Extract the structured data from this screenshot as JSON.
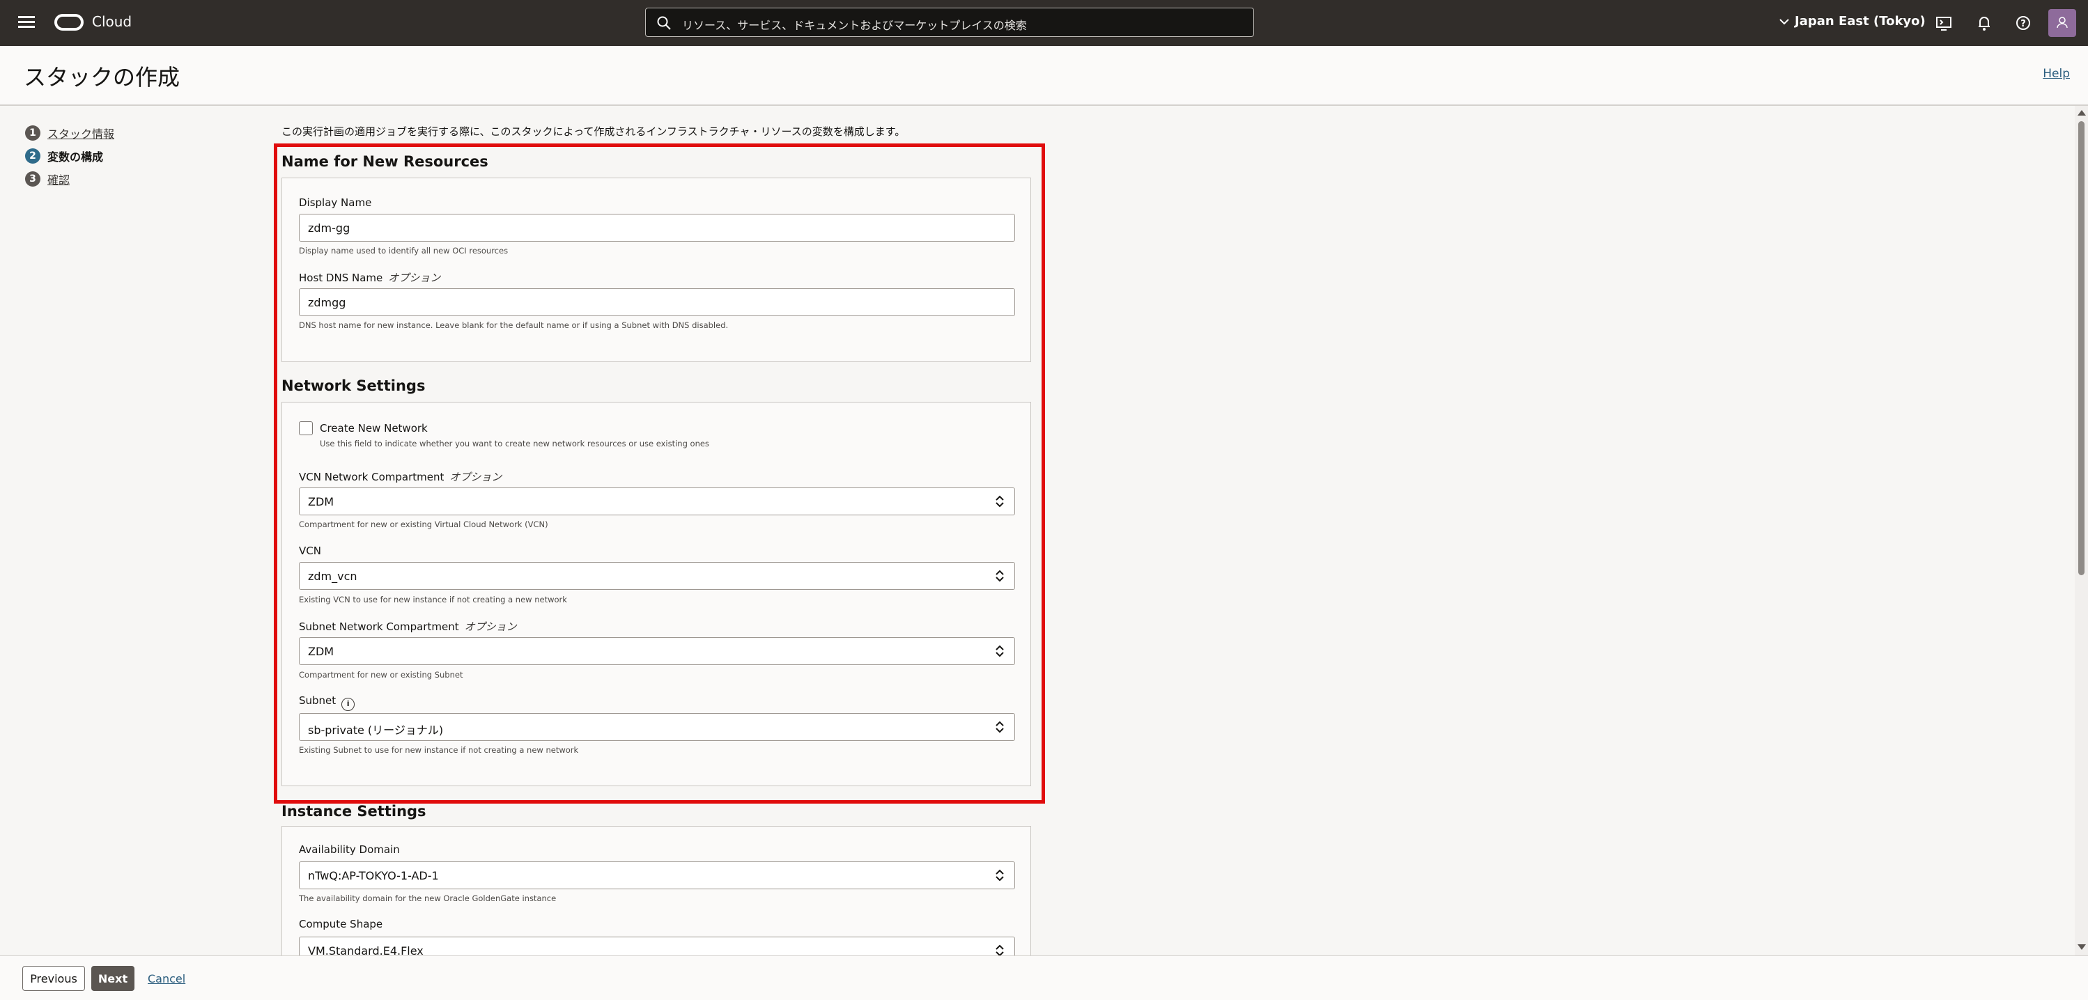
{
  "topbar": {
    "brand": "Cloud",
    "search_placeholder": "リソース、サービス、ドキュメントおよびマーケットプレイスの検索",
    "region": "Japan East (Tokyo)"
  },
  "header": {
    "title": "スタックの作成",
    "help": "Help"
  },
  "steps": [
    {
      "num": "1",
      "label": "スタック情報"
    },
    {
      "num": "2",
      "label": "変数の構成"
    },
    {
      "num": "3",
      "label": "確認"
    }
  ],
  "intro": "この実行計画の適用ジョブを実行する際に、このスタックによって作成されるインフラストラクチャ・リソースの変数を構成します。",
  "sections": {
    "names": {
      "title": "Name for New Resources",
      "display_name_label": "Display Name",
      "display_name_value": "zdm-gg",
      "display_name_hint": "Display name used to identify all new OCI resources",
      "host_dns_label": "Host DNS Name",
      "optional": "オプション",
      "host_dns_value": "zdmgg",
      "host_dns_hint": "DNS host name for new instance. Leave blank for the default name or if using a Subnet with DNS disabled."
    },
    "network": {
      "title": "Network Settings",
      "create_network_label": "Create New Network",
      "create_network_hint": "Use this field to indicate whether you want to create new network resources or use existing ones",
      "vcn_compartment_label": "VCN Network Compartment",
      "vcn_compartment_value": "ZDM",
      "vcn_compartment_hint": "Compartment for new or existing Virtual Cloud Network (VCN)",
      "vcn_label": "VCN",
      "vcn_value": "zdm_vcn",
      "vcn_hint": "Existing VCN to use for new instance if not creating a new network",
      "subnet_compartment_label": "Subnet Network Compartment",
      "subnet_compartment_value": "ZDM",
      "subnet_compartment_hint": "Compartment for new or existing Subnet",
      "subnet_label": "Subnet",
      "subnet_value": "sb-private (リージョナル)",
      "subnet_hint": "Existing Subnet to use for new instance if not creating a new network"
    },
    "instance": {
      "title": "Instance Settings",
      "ad_label": "Availability Domain",
      "ad_value": "nTwQ:AP-TOKYO-1-AD-1",
      "ad_hint": "The availability domain for the new Oracle GoldenGate instance",
      "shape_label": "Compute Shape",
      "shape_value": "VM.Standard.E4.Flex"
    }
  },
  "footer": {
    "previous": "Previous",
    "next": "Next",
    "cancel": "Cancel"
  },
  "colors": {
    "topbar": "#312d2a",
    "highlight": "#e00c0c",
    "link": "#2b5d7e",
    "active_step": "#2f6b8a"
  }
}
